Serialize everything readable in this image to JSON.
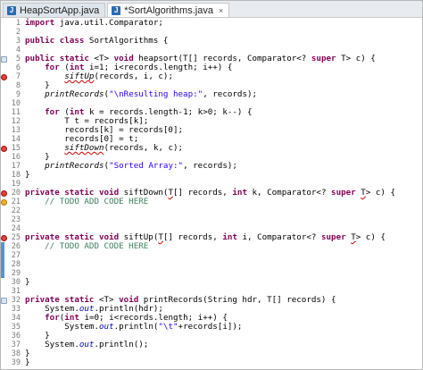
{
  "tabs": [
    {
      "label": "HeapSortApp.java",
      "active": false
    },
    {
      "label": "*SortAlgorithms.java",
      "active": true,
      "close": "×"
    }
  ],
  "lines": [
    {
      "n": "1",
      "html": "<span class=\"kw\">import</span> java.util.Comparator;"
    },
    {
      "n": "2",
      "html": ""
    },
    {
      "n": "3",
      "html": "<span class=\"kw\">public class</span> SortAlgorithms {"
    },
    {
      "n": "4",
      "html": ""
    },
    {
      "n": "5",
      "html": "<span class=\"kw\">public static</span> &lt;T&gt; <span class=\"kw\">void</span> heapsort(T[] records, Comparator&lt;? <span class=\"kw\">super</span> T&gt; c) {",
      "mark": "fold"
    },
    {
      "n": "6",
      "html": "    <span class=\"kw\">for</span> (<span class=\"kw\">int</span> i=1; i&lt;records.length; i++) {"
    },
    {
      "n": "7",
      "html": "        <span class=\"it err\">siftUp</span>(records, i, c);",
      "mark": "err"
    },
    {
      "n": "8",
      "html": "    }"
    },
    {
      "n": "9",
      "html": "    <span class=\"it\">printRecords</span>(<span class=\"str\">\"\\nResulting heap:\"</span>, records);"
    },
    {
      "n": "10",
      "html": ""
    },
    {
      "n": "11",
      "html": "    <span class=\"kw\">for</span> (<span class=\"kw\">int</span> k = records.length-1; k&gt;0; k--) {"
    },
    {
      "n": "12",
      "html": "        T t = records[k];"
    },
    {
      "n": "13",
      "html": "        records[k] = records[0];"
    },
    {
      "n": "14",
      "html": "        records[0] = t;"
    },
    {
      "n": "15",
      "html": "        <span class=\"it err\">siftDown</span>(records, k, c);",
      "mark": "err"
    },
    {
      "n": "16",
      "html": "    }"
    },
    {
      "n": "17",
      "html": "    <span class=\"it\">printRecords</span>(<span class=\"str\">\"Sorted Array:\"</span>, records);"
    },
    {
      "n": "18",
      "html": "}"
    },
    {
      "n": "19",
      "html": ""
    },
    {
      "n": "20",
      "html": "<span class=\"kw\">private static void</span> siftDown(<span class=\"err\">T</span>[] records, <span class=\"kw\">int</span> k, Comparator&lt;? <span class=\"kw\">super</span> <span class=\"err\">T</span>&gt; c) {",
      "mark": "err"
    },
    {
      "n": "21",
      "html": "    <span class=\"cm\">// TODO ADD CODE HERE</span>",
      "mark": "warn"
    },
    {
      "n": "22",
      "html": ""
    },
    {
      "n": "23",
      "html": ""
    },
    {
      "n": "24",
      "html": ""
    },
    {
      "n": "25",
      "html": "<span class=\"kw\">private static void</span> siftUp(<span class=\"err\">T</span>[] records, <span class=\"kw\">int</span> i, Comparator&lt;? <span class=\"kw\">super</span> <span class=\"err\">T</span>&gt; c) {",
      "mark": "err"
    },
    {
      "n": "26",
      "html": "    <span class=\"cm\">// TODO ADD CODE HERE</span>",
      "change": true
    },
    {
      "n": "27",
      "html": "",
      "change": true
    },
    {
      "n": "28",
      "html": "",
      "change": true
    },
    {
      "n": "29",
      "html": "",
      "change": true
    },
    {
      "n": "30",
      "html": "}"
    },
    {
      "n": "31",
      "html": ""
    },
    {
      "n": "32",
      "html": "<span class=\"kw\">private static</span> &lt;T&gt; <span class=\"kw\">void</span> printRecords(String hdr, T[] records) {",
      "mark": "fold"
    },
    {
      "n": "33",
      "html": "    System.<span class=\"it\" style=\"color:#0000c0\">out</span>.println(hdr);"
    },
    {
      "n": "34",
      "html": "    <span class=\"kw\">for</span>(<span class=\"kw\">int</span> i=0; i&lt;records.length; i++) {"
    },
    {
      "n": "35",
      "html": "        System.<span class=\"it\" style=\"color:#0000c0\">out</span>.println(<span class=\"str\">\"\\t\"</span>+records[i]);"
    },
    {
      "n": "36",
      "html": "    }"
    },
    {
      "n": "37",
      "html": "    System.<span class=\"it\" style=\"color:#0000c0\">out</span>.println();"
    },
    {
      "n": "38",
      "html": "}"
    },
    {
      "n": "39",
      "html": "}"
    }
  ]
}
